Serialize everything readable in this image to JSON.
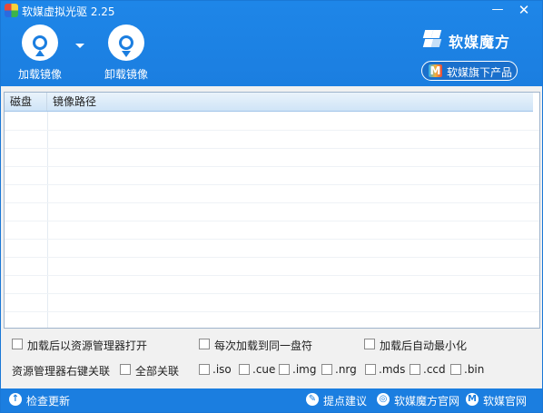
{
  "window": {
    "title": "软媒虚拟光驱 2.25",
    "minimize": "—",
    "close": "✕"
  },
  "toolbar": {
    "mount_label": "加载镜像",
    "unmount_label": "卸载镜像"
  },
  "brand": {
    "name": "软媒魔方",
    "products_label": "软媒旗下产品",
    "products_icon_text": "M"
  },
  "table": {
    "columns": [
      "磁盘",
      "镜像路径"
    ],
    "rows": []
  },
  "options": {
    "open_explorer_after_mount": "加载后以资源管理器打开",
    "same_drive_letter": "每次加载到同一盘符",
    "minimize_after_mount": "加载后自动最小化",
    "explorer_context_assoc": "资源管理器右键关联",
    "assoc_all": "全部关联",
    "extensions": [
      ".iso",
      ".cue",
      ".img",
      ".nrg",
      ".mds",
      ".ccd",
      ".bin"
    ]
  },
  "footer": {
    "check_update": "检查更新",
    "suggest": "提点建议",
    "mofang_site": "软媒魔方官网",
    "ruanmei_site": "软媒官网"
  },
  "colors": {
    "accent": "#1b7ee0",
    "header_bg": "#1e86e8",
    "table_header": "#cfe4f7"
  }
}
